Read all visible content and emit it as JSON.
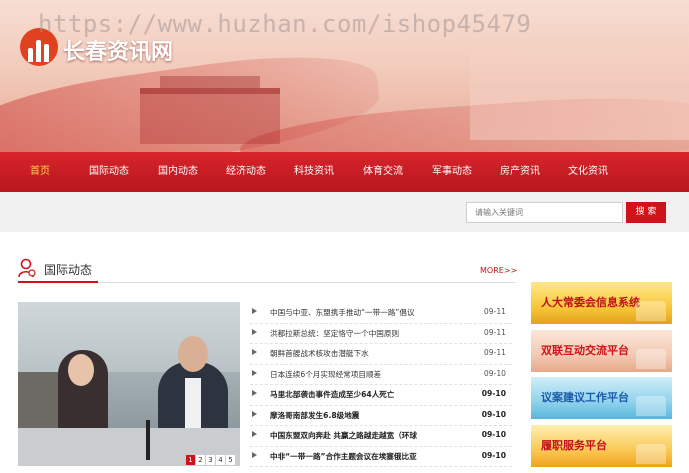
{
  "watermark": "https://www.huzhan.com/ishop45479",
  "site": {
    "name": "长春资讯网"
  },
  "nav": {
    "items": [
      {
        "label": "首页",
        "active": true
      },
      {
        "label": "国际动态"
      },
      {
        "label": "国内动态"
      },
      {
        "label": "经济动态"
      },
      {
        "label": "科技资讯"
      },
      {
        "label": "体育交流"
      },
      {
        "label": "军事动态"
      },
      {
        "label": "房产资讯"
      },
      {
        "label": "文化资讯"
      }
    ]
  },
  "search": {
    "placeholder": "请输入关键词",
    "button_label": "搜 索"
  },
  "section": {
    "title": "国际动态",
    "more": "MORE>>"
  },
  "slideshow": {
    "pages": [
      "1",
      "2",
      "3",
      "4",
      "5"
    ],
    "active_page": "1"
  },
  "news": [
    {
      "title": "中国与中亚、东盟携手推动“一带一路”倡议",
      "date": "09-11"
    },
    {
      "title": "洪都拉斯总统：坚定恪守一个中国原则",
      "date": "09-11"
    },
    {
      "title": "朝鲜首艘战术核攻击潜艇下水",
      "date": "09-11"
    },
    {
      "title": "日本连续6个月实现经常项目顺差",
      "date": "09-10"
    },
    {
      "title": "马里北部袭击事件造成至少64人死亡",
      "date": "09-10"
    },
    {
      "title": "摩洛哥南部发生6.8级地震",
      "date": "09-10"
    },
    {
      "title": "中国东盟双向奔赴 共赢之路越走越宽（环球",
      "date": "09-10"
    },
    {
      "title": "中非“一带一路”合作主题会议在埃塞俄比亚",
      "date": "09-10"
    }
  ],
  "side_banners": [
    {
      "label": "人大常委会信息系统"
    },
    {
      "label": "双联互动交流平台"
    },
    {
      "label": "议案建议工作平台"
    },
    {
      "label": "履职服务平台"
    }
  ],
  "colors": {
    "brand_red": "#d0121b",
    "nav_active": "#ffd24a"
  }
}
